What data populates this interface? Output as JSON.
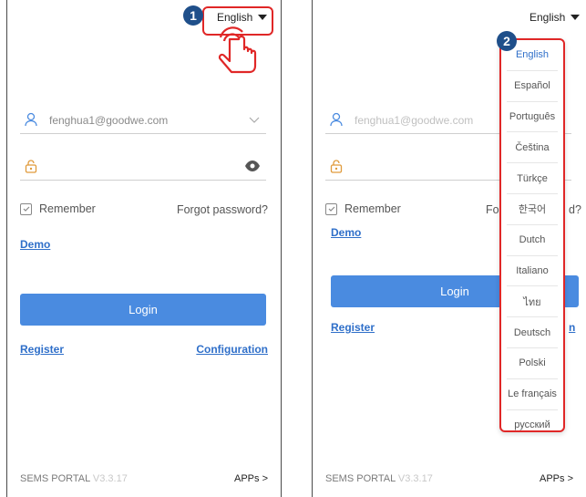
{
  "badges": {
    "one": "1",
    "two": "2"
  },
  "language": {
    "selected": "English"
  },
  "login": {
    "email": "fenghua1@goodwe.com",
    "remember_label": "Remember",
    "forgot_label": "Forgot password?",
    "demo_label": "Demo",
    "login_button": "Login",
    "register_label": "Register",
    "configuration_label": "Configuration"
  },
  "footer": {
    "brand": "SEMS PORTAL",
    "version": "V3.3.17",
    "apps_label": "APPs >"
  },
  "dropdown": {
    "options": [
      "English",
      "Español",
      "Português",
      "Čeština",
      "Türkçe",
      "한국어",
      "Dutch",
      "Italiano",
      "ไทย",
      "Deutsch",
      "Polski",
      "Le français",
      "русский"
    ]
  },
  "partials": {
    "forgot_start": "Fo",
    "forgot_end": "d?",
    "config_end": "n"
  },
  "colors": {
    "accent": "#4a8be0",
    "link": "#2f6fc9",
    "highlight": "#e02727",
    "badge": "#1f4f8a"
  }
}
